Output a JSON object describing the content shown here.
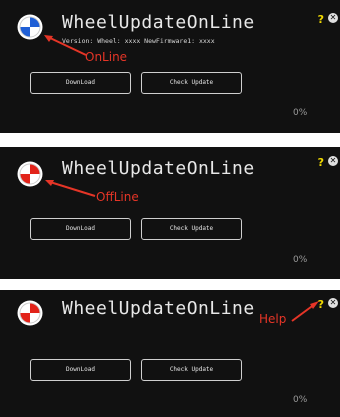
{
  "colors": {
    "panel_bg": "#111111",
    "annotation_red": "#e53527",
    "help_yellow": "#f1d900",
    "logo_online": "#1f5fd6",
    "logo_offline": "#e2231a"
  },
  "panels": [
    {
      "state": "online",
      "title": "WheelUpdateOnLine",
      "subtitle": "Version: Wheel: xxxx NewFirmware1: xxxx",
      "download_label": "DownLoad",
      "check_label": "Check Update",
      "progress": "0%",
      "help": "?",
      "close": "✕",
      "annotation": "OnLine",
      "icons": {
        "logo": "status-logo-online",
        "help": "help-icon",
        "close": "close-icon"
      }
    },
    {
      "state": "offline",
      "title": "WheelUpdateOnLine",
      "download_label": "DownLoad",
      "check_label": "Check Update",
      "progress": "0%",
      "help": "?",
      "close": "✕",
      "annotation": "OffLine",
      "icons": {
        "logo": "status-logo-offline",
        "help": "help-icon",
        "close": "close-icon"
      }
    },
    {
      "state": "offline",
      "title": "WheelUpdateOnLine",
      "download_label": "DownLoad",
      "check_label": "Check Update",
      "progress": "0%",
      "help": "?",
      "close": "✕",
      "annotation": "Help",
      "icons": {
        "logo": "status-logo-offline",
        "help": "help-icon",
        "close": "close-icon"
      }
    }
  ]
}
